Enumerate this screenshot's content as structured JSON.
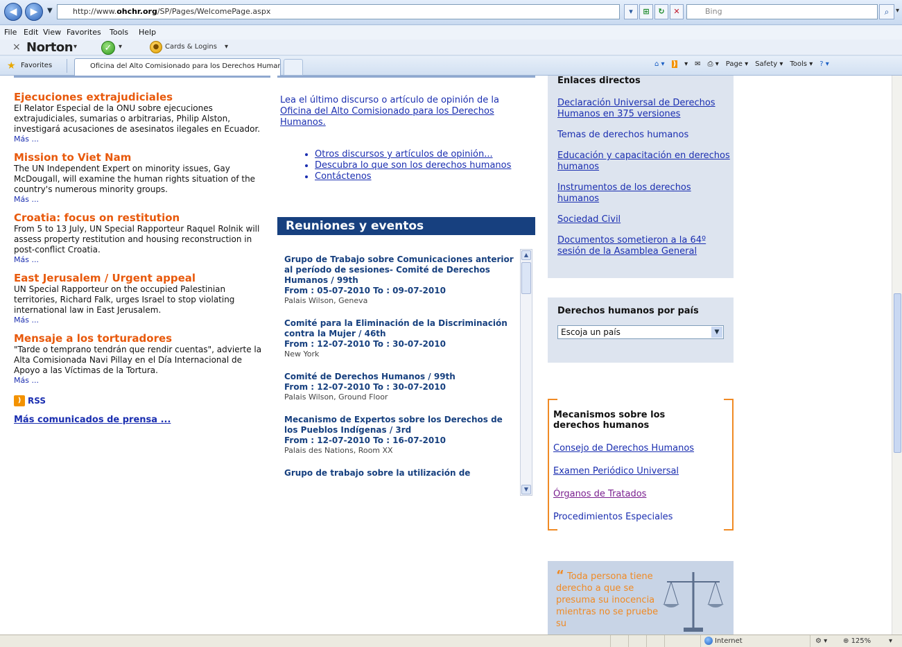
{
  "browser": {
    "address": {
      "prefix": "http://www.",
      "domain": "ohchr.org",
      "path": "/SP/Pages/WelcomePage.aspx"
    },
    "search_placeholder": "Bing",
    "menu": [
      "File",
      "Edit",
      "View",
      "Favorites",
      "Tools",
      "Help"
    ],
    "norton": {
      "close": "×",
      "logo": "Norton",
      "safe_search": "Safe Search",
      "cookies_label": "Cards & Logins"
    },
    "favorites_label": "Favorites",
    "tab_title": "Oficina del Alto Comisionado para los Derechos Humanos",
    "commands": {
      "page": "Page",
      "safety": "Safety",
      "tools": "Tools"
    }
  },
  "left": {
    "news": [
      {
        "title": "Ejecuciones extrajudiciales",
        "body": "El Relator Especial de la ONU sobre ejecuciones extrajudiciales, sumarias o arbitrarias, Philip Alston, investigará acusaciones de asesinatos ilegales en Ecuador.",
        "more": "Más ..."
      },
      {
        "title": "Mission to Viet Nam",
        "body": "The UN Independent Expert on minority issues, Gay McDougall, will examine the human rights situation of the country's numerous minority groups.",
        "more": "Más ..."
      },
      {
        "title": "Croatia: focus on restitution",
        "body": "From 5 to 13 July, UN Special Rapporteur Raquel Rolnik will assess property restitution and housing reconstruction in post-conflict Croatia.",
        "more": "Más ..."
      },
      {
        "title": "East Jerusalem / Urgent appeal",
        "body": "UN Special Rapporteur on the occupied Palestinian territories, Richard Falk, urges Israel to stop violating international law in East Jerusalem.",
        "more": "Más ..."
      },
      {
        "title": "Mensaje a los torturadores",
        "body": "\"Tarde o temprano tendrán que rendir cuentas\", advierte la Alta Comisionada Navi Pillay en el Día Internacional de Apoyo a las Víctimas de la Tortura.",
        "more": "Más ..."
      }
    ],
    "rss_label": "RSS",
    "press_link": "Más comunicados de prensa ..."
  },
  "middle": {
    "speech_prefix": "Lea el último discurso o artículo de opinión de la ",
    "speech_link": "Oficina del Alto Comisionado para los Derechos Humanos.",
    "bullets": [
      "Otros discursos y artículos de opinión...",
      "Descubra lo que son los derechos humanos",
      "Contáctenos"
    ],
    "events_heading": "Reuniones y eventos",
    "events": [
      {
        "title": "Grupo de Trabajo sobre Comunicaciones anterior al período de sesiones- Comité de Derechos Humanos / 99th",
        "date": "From : 05-07-2010 To : 09-07-2010",
        "place": "Palais Wilson, Geneva"
      },
      {
        "title": "Comité para la Eliminación de la Discriminación contra la Mujer / 46th",
        "date": "From : 12-07-2010 To : 30-07-2010",
        "place": "New York"
      },
      {
        "title": "Comité de Derechos Humanos / 99th",
        "date": "From : 12-07-2010 To : 30-07-2010",
        "place": "Palais Wilson, Ground Floor"
      },
      {
        "title": "Mecanismo de Expertos sobre los Derechos de los Pueblos Indígenas / 3rd",
        "date": "From : 12-07-2010 To : 16-07-2010",
        "place": "Palais des Nations, Room XX"
      },
      {
        "title": "Grupo de trabajo sobre la utilización de",
        "date": "",
        "place": ""
      }
    ]
  },
  "right": {
    "links_title": "Enlaces directos",
    "links": [
      "Declaración Universal de Derechos Humanos en 375 versiones",
      "Temas de derechos humanos",
      "Educación y capacitación en derechos humanos",
      "Instrumentos de los derechos humanos",
      "Sociedad Civil",
      "Documentos sometieron a la 64º sesión de la Asamblea General"
    ],
    "country_title": "Derechos humanos por país",
    "country_select": "Escoja un país",
    "mech_title": "Mecanismos sobre los derechos humanos",
    "mech_links": [
      "Consejo de Derechos Humanos",
      "Examen Periódico Universal",
      "Órganos de Tratados",
      "Procedimientos Especiales"
    ],
    "quote": "Toda persona tiene derecho a que se presuma su inocencia mientras no se pruebe su"
  },
  "status": {
    "zone": "Internet",
    "zoom": "125%"
  }
}
